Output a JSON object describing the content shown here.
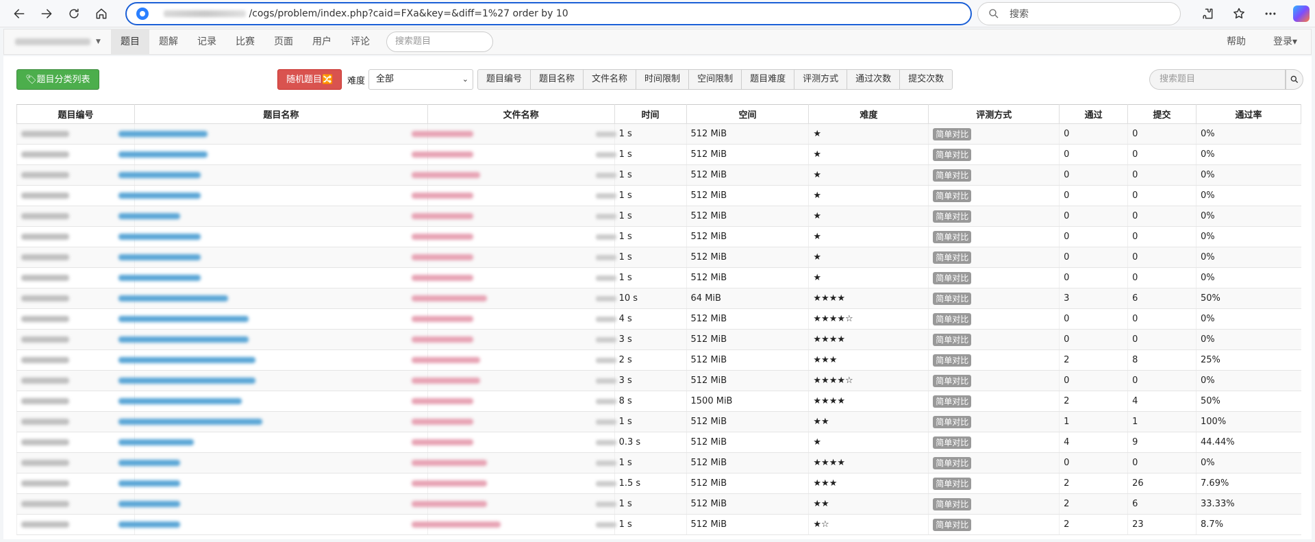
{
  "browser": {
    "url_text": "/cogs/problem/index.php?caid=FXa&key=&diff=1%27 order by 10",
    "search_placeholder": "搜索"
  },
  "nav": {
    "items": [
      "题目",
      "题解",
      "记录",
      "比赛",
      "页面",
      "用户",
      "评论"
    ],
    "search_placeholder": "搜索题目",
    "help": "帮助",
    "login": "登录▾"
  },
  "toolbar": {
    "category_btn": "🏷题目分类列表",
    "random_btn": "随机题目🔀",
    "difficulty_label": "难度",
    "difficulty_value": "全部",
    "sort_buttons": [
      "题目编号",
      "题目名称",
      "文件名称",
      "时间限制",
      "空间限制",
      "题目难度",
      "评测方式",
      "通过次数",
      "提交次数"
    ],
    "search_placeholder": "搜索题目"
  },
  "table": {
    "headers": [
      "题目编号",
      "题目名称",
      "文件名称",
      "时间",
      "空间",
      "难度",
      "评测方式",
      "通过",
      "提交",
      "通过率"
    ],
    "rows": [
      {
        "time": "1 s",
        "mem": "512 MiB",
        "diff": "★",
        "judge": "简单对比",
        "ac": "0",
        "sub": "0",
        "rate": "0%",
        "nw": 130,
        "fw": 90
      },
      {
        "time": "1 s",
        "mem": "512 MiB",
        "diff": "★",
        "judge": "简单对比",
        "ac": "0",
        "sub": "0",
        "rate": "0%",
        "nw": 130,
        "fw": 90
      },
      {
        "time": "1 s",
        "mem": "512 MiB",
        "diff": "★",
        "judge": "简单对比",
        "ac": "0",
        "sub": "0",
        "rate": "0%",
        "nw": 120,
        "fw": 100
      },
      {
        "time": "1 s",
        "mem": "512 MiB",
        "diff": "★",
        "judge": "简单对比",
        "ac": "0",
        "sub": "0",
        "rate": "0%",
        "nw": 120,
        "fw": 90
      },
      {
        "time": "1 s",
        "mem": "512 MiB",
        "diff": "★",
        "judge": "简单对比",
        "ac": "0",
        "sub": "0",
        "rate": "0%",
        "nw": 90,
        "fw": 90
      },
      {
        "time": "1 s",
        "mem": "512 MiB",
        "diff": "★",
        "judge": "简单对比",
        "ac": "0",
        "sub": "0",
        "rate": "0%",
        "nw": 120,
        "fw": 90
      },
      {
        "time": "1 s",
        "mem": "512 MiB",
        "diff": "★",
        "judge": "简单对比",
        "ac": "0",
        "sub": "0",
        "rate": "0%",
        "nw": 120,
        "fw": 90
      },
      {
        "time": "1 s",
        "mem": "512 MiB",
        "diff": "★",
        "judge": "简单对比",
        "ac": "0",
        "sub": "0",
        "rate": "0%",
        "nw": 120,
        "fw": 90
      },
      {
        "time": "10 s",
        "mem": "64 MiB",
        "diff": "★★★★",
        "judge": "简单对比",
        "ac": "3",
        "sub": "6",
        "rate": "50%",
        "nw": 160,
        "fw": 110
      },
      {
        "time": "4 s",
        "mem": "512 MiB",
        "diff": "★★★★☆",
        "judge": "简单对比",
        "ac": "0",
        "sub": "0",
        "rate": "0%",
        "nw": 190,
        "fw": 90
      },
      {
        "time": "3 s",
        "mem": "512 MiB",
        "diff": "★★★★",
        "judge": "简单对比",
        "ac": "0",
        "sub": "0",
        "rate": "0%",
        "nw": 190,
        "fw": 90
      },
      {
        "time": "2 s",
        "mem": "512 MiB",
        "diff": "★★★",
        "judge": "简单对比",
        "ac": "2",
        "sub": "8",
        "rate": "25%",
        "nw": 200,
        "fw": 100
      },
      {
        "time": "3 s",
        "mem": "512 MiB",
        "diff": "★★★★☆",
        "judge": "简单对比",
        "ac": "0",
        "sub": "0",
        "rate": "0%",
        "nw": 200,
        "fw": 100
      },
      {
        "time": "8 s",
        "mem": "1500 MiB",
        "diff": "★★★★",
        "judge": "简单对比",
        "ac": "2",
        "sub": "4",
        "rate": "50%",
        "nw": 180,
        "fw": 90
      },
      {
        "time": "1 s",
        "mem": "512 MiB",
        "diff": "★★",
        "judge": "简单对比",
        "ac": "1",
        "sub": "1",
        "rate": "100%",
        "nw": 210,
        "fw": 90
      },
      {
        "time": "0.3 s",
        "mem": "512 MiB",
        "diff": "★",
        "judge": "简单对比",
        "ac": "4",
        "sub": "9",
        "rate": "44.44%",
        "nw": 110,
        "fw": 90
      },
      {
        "time": "1 s",
        "mem": "512 MiB",
        "diff": "★★★★",
        "judge": "简单对比",
        "ac": "0",
        "sub": "0",
        "rate": "0%",
        "nw": 90,
        "fw": 110
      },
      {
        "time": "1.5 s",
        "mem": "512 MiB",
        "diff": "★★★",
        "judge": "简单对比",
        "ac": "2",
        "sub": "26",
        "rate": "7.69%",
        "nw": 90,
        "fw": 110
      },
      {
        "time": "1 s",
        "mem": "512 MiB",
        "diff": "★★",
        "judge": "简单对比",
        "ac": "2",
        "sub": "6",
        "rate": "33.33%",
        "nw": 90,
        "fw": 110
      },
      {
        "time": "1 s",
        "mem": "512 MiB",
        "diff": "★☆",
        "judge": "简单对比",
        "ac": "2",
        "sub": "23",
        "rate": "8.7%",
        "nw": 90,
        "fw": 130
      }
    ]
  }
}
